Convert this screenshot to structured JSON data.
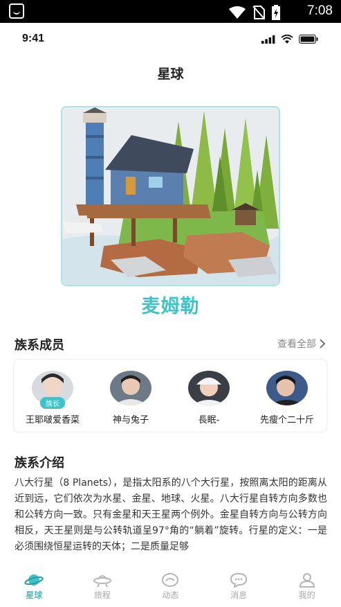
{
  "android_status": {
    "clock": "7:08"
  },
  "ios_status": {
    "time": "9:41"
  },
  "header": {
    "title": "星球"
  },
  "hero": {
    "planet_name": "麦姆勒"
  },
  "members": {
    "title": "族系成员",
    "view_all": "查看全部",
    "items": [
      {
        "name": "王耶啵爱香菜",
        "badge": "族长"
      },
      {
        "name": "神与兔子"
      },
      {
        "name": "長眠-"
      },
      {
        "name": "先瘦个二十斤"
      }
    ]
  },
  "intro": {
    "title": "族系介绍",
    "text": "八大行星（8 Planets），是指太阳系的八个大行星，按照离太阳的距离从近到远，它们依次为水星、金星、地球、火星。八大行星自转方向多数也和公转方向一致。只有金星和天王星两个例外。金星自转方向与公转方向相反，天王星则是与公转轨道呈97°角的“躺着”旋转。行星的定义：一是必须围绕恒星运转的天体；二是质量足够"
  },
  "tabbar": {
    "items": [
      {
        "label": "星球",
        "active": true
      },
      {
        "label": "旅程"
      },
      {
        "label": "动态"
      },
      {
        "label": "消息"
      },
      {
        "label": "我的"
      }
    ]
  },
  "colors": {
    "accent": "#3ec3c9",
    "inactive": "#a8a8a8"
  }
}
